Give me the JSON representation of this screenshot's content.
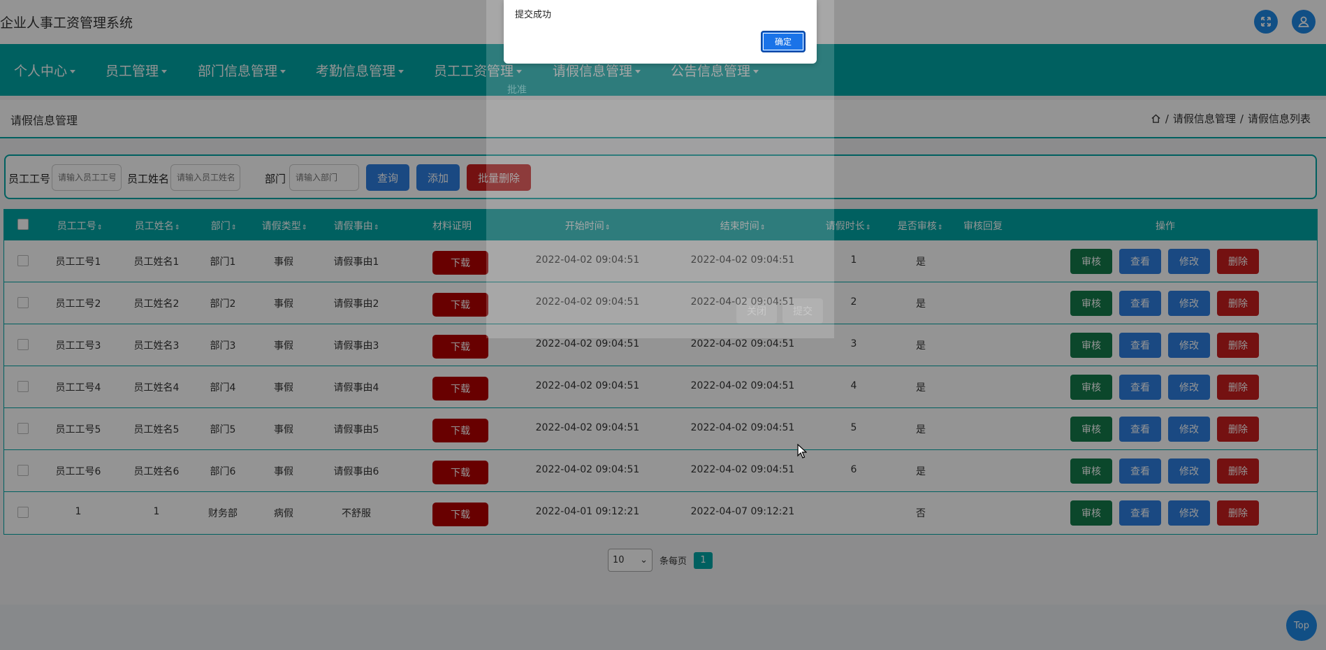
{
  "app": {
    "title": "企业人事工资管理系统"
  },
  "header_icons": [
    "fullscreen-icon",
    "user-icon"
  ],
  "nav": [
    "个人中心",
    "员工管理",
    "部门信息管理",
    "考勤信息管理",
    "员工工资管理",
    "请假信息管理",
    "公告信息管理"
  ],
  "page": {
    "title": "请假信息管理",
    "breadcrumb": [
      "请假信息管理",
      "请假信息列表"
    ],
    "separator": "/"
  },
  "search": {
    "emp_no_label": "员工工号",
    "emp_no_placeholder": "请输入员工工号",
    "emp_name_label": "员工姓名",
    "emp_name_placeholder": "请输入员工姓名",
    "dept_label": "部门",
    "dept_placeholder": "请输入部门",
    "query_label": "查询",
    "add_label": "添加",
    "batch_delete_label": "批量删除"
  },
  "table": {
    "columns": [
      "员工工号",
      "员工姓名",
      "部门",
      "请假类型",
      "请假事由",
      "材料证明",
      "开始时间",
      "结束时间",
      "请假时长",
      "是否审核",
      "审核回复",
      "操作"
    ],
    "sort_glyph": "⇕",
    "download_label": "下载",
    "actions": {
      "audit": "审核",
      "view": "查看",
      "edit": "修改",
      "delete": "删除"
    },
    "rows": [
      {
        "emp_no": "员工工号1",
        "emp_name": "员工姓名1",
        "dept": "部门1",
        "type": "事假",
        "reason": "请假事由1",
        "start": "2022-04-02 09:04:51",
        "end": "2022-04-02 09:04:51",
        "duration": "1",
        "audited": "是"
      },
      {
        "emp_no": "员工工号2",
        "emp_name": "员工姓名2",
        "dept": "部门2",
        "type": "事假",
        "reason": "请假事由2",
        "start": "2022-04-02 09:04:51",
        "end": "2022-04-02 09:04:51",
        "duration": "2",
        "audited": "是"
      },
      {
        "emp_no": "员工工号3",
        "emp_name": "员工姓名3",
        "dept": "部门3",
        "type": "事假",
        "reason": "请假事由3",
        "start": "2022-04-02 09:04:51",
        "end": "2022-04-02 09:04:51",
        "duration": "3",
        "audited": "是"
      },
      {
        "emp_no": "员工工号4",
        "emp_name": "员工姓名4",
        "dept": "部门4",
        "type": "事假",
        "reason": "请假事由4",
        "start": "2022-04-02 09:04:51",
        "end": "2022-04-02 09:04:51",
        "duration": "4",
        "audited": "是"
      },
      {
        "emp_no": "员工工号5",
        "emp_name": "员工姓名5",
        "dept": "部门5",
        "type": "事假",
        "reason": "请假事由5",
        "start": "2022-04-02 09:04:51",
        "end": "2022-04-02 09:04:51",
        "duration": "5",
        "audited": "是"
      },
      {
        "emp_no": "员工工号6",
        "emp_name": "员工姓名6",
        "dept": "部门6",
        "type": "事假",
        "reason": "请假事由6",
        "start": "2022-04-02 09:04:51",
        "end": "2022-04-02 09:04:51",
        "duration": "6",
        "audited": "是"
      },
      {
        "emp_no": "1",
        "emp_name": "1",
        "dept": "财务部",
        "type": "病假",
        "reason": "不舒服",
        "start": "2022-04-01 09:12:21",
        "end": "2022-04-07 09:12:21",
        "duration": "",
        "audited": "否"
      }
    ]
  },
  "pagination": {
    "page_size": "10",
    "per_page_label": "条每页",
    "current_page": "1"
  },
  "top_button": "Top",
  "background_dialog": {
    "label": "批准",
    "cancel": "关闭",
    "submit": "提交"
  },
  "alert": {
    "message": "提交成功",
    "ok_label": "确定"
  },
  "colors": {
    "primary": "#00a6a6",
    "blue": "#2d7fe0",
    "danger": "#c81e1e",
    "success": "#137a4a",
    "download": "#b40000"
  }
}
